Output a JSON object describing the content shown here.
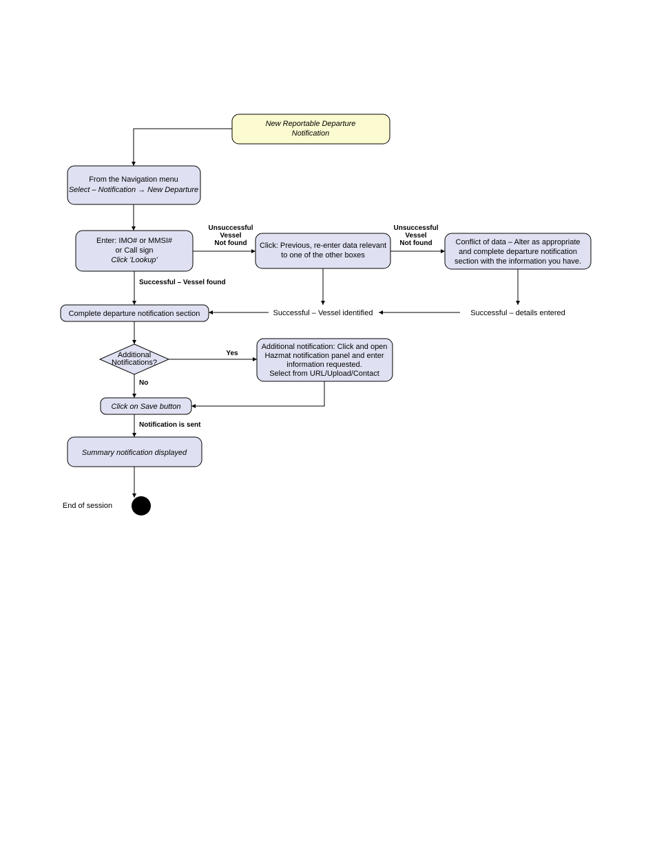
{
  "start": {
    "l1": "New Reportable Departure",
    "l2": "Notification"
  },
  "nav": {
    "l1": "From the Navigation menu",
    "l2": "Select – Notification → New Departure"
  },
  "enter": {
    "l1": "Enter: IMO# or MMSI#",
    "l2": "or Call sign",
    "l3": "Click 'Lookup'"
  },
  "previous": "Click: Previous, re-enter data relevant to one of the other boxes",
  "conflict": "Conflict of data – Alter as appropriate and complete departure notification section with the information you have.",
  "complete": "Complete departure notification section",
  "addnot": {
    "l1": "Additional notification: Click and open",
    "l2": "Hazmat notification panel and enter",
    "l3": "information requested.",
    "l4": "Select from URL/Upload/Contact"
  },
  "save": "Click on Save button",
  "summary": "Summary notification displayed",
  "end": "End of session",
  "dec": {
    "l1": "Additional",
    "l2": "Notifications?"
  },
  "lbl": {
    "unsucc1": "Unsuccessful",
    "unsucc2": "Vessel",
    "unsucc3": "Not found",
    "succfound": "Successful – Vessel found",
    "succid": "Successful – Vessel identified",
    "succdet": "Successful – details entered",
    "yes": "Yes",
    "no": "No",
    "sent": "Notification is sent"
  }
}
